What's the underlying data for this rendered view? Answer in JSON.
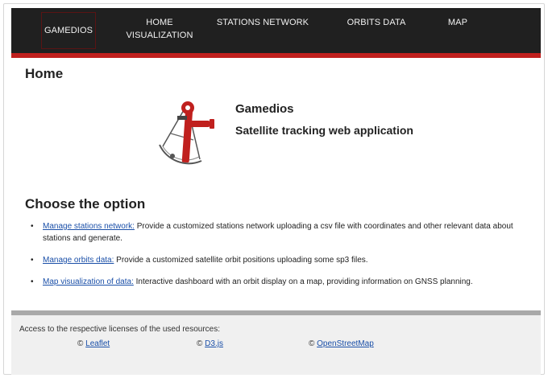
{
  "nav": {
    "brand": "GAMEDIOS",
    "home": "HOME VISUALIZATION",
    "stations": "STATIONS NETWORK",
    "orbits": "ORBITS DATA",
    "map": "MAP"
  },
  "page": {
    "title": "Home"
  },
  "app": {
    "name": "Gamedios",
    "subtitle": "Satellite tracking web application",
    "logo_icon": "sextant-icon"
  },
  "choose": {
    "heading": "Choose the option",
    "items": [
      {
        "link": "Manage stations network:",
        "text": " Provide a customized stations network uploading a csv file with coordinates and other relevant data about stations and generate."
      },
      {
        "link": "Manage orbits data:",
        "text": " Provide a customized satellite orbit positions uploading some sp3 files."
      },
      {
        "link": "Map visualization of data:",
        "text": " Interactive dashboard with an orbit display on a map, providing information on GNSS planning."
      }
    ]
  },
  "footer": {
    "text": "Access to the respective licenses of the used resources:",
    "licenses": [
      {
        "symbol": "©",
        "name": "Leaflet"
      },
      {
        "symbol": "©",
        "name": "D3.js"
      },
      {
        "symbol": "©",
        "name": "OpenStreetMap"
      }
    ]
  },
  "colors": {
    "nav_bg": "#202020",
    "accent_red": "#c0201e",
    "link": "#1a4fa8",
    "footer_bg": "#f0f0f0"
  }
}
